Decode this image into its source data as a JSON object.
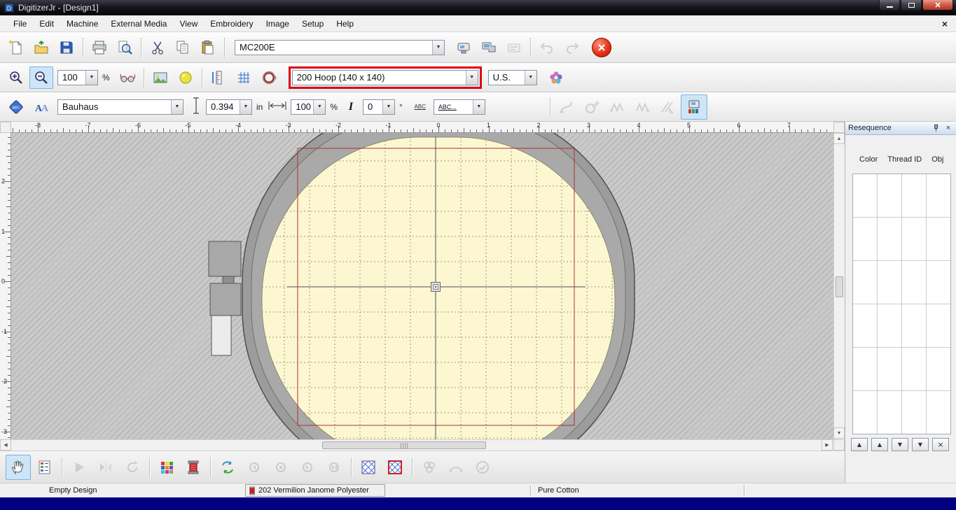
{
  "titlebar": {
    "title": "DigitizerJr - [Design1]"
  },
  "menubar": {
    "items": [
      "File",
      "Edit",
      "Machine",
      "External Media",
      "View",
      "Embroidery",
      "Image",
      "Setup",
      "Help"
    ]
  },
  "toolbar_standard": {
    "machine_value": "MC200E"
  },
  "toolbar_view": {
    "zoom_value": "100",
    "zoom_percent": "%",
    "hoop_value": "200 Hoop (140 x 140)",
    "units_value": "U.S."
  },
  "toolbar_lettering": {
    "font_value": "Bauhaus",
    "height_value": "0.394",
    "height_unit": "in",
    "width_value": "100",
    "width_percent": "%",
    "italic_glyph": "I",
    "angle_value": "0",
    "angle_unit": "°",
    "abc_glyph": "ABC",
    "baseline_value": "ABC..."
  },
  "rulers": {
    "horizontal_labels": [
      "-8",
      "-7",
      "-6",
      "-5",
      "-4",
      "-3",
      "-2",
      "-1",
      "0",
      "1",
      "2",
      "3",
      "4",
      "5",
      "6",
      "7"
    ],
    "vertical_labels": [
      "2",
      "1",
      "0",
      "-1",
      "-2",
      "-3"
    ]
  },
  "resequence": {
    "title": "Resequence",
    "columns": [
      "Color",
      "Thread ID",
      "Obj"
    ],
    "buttons": [
      "▲",
      "▲",
      "▼",
      "▼",
      "×"
    ]
  },
  "statusbar": {
    "design_status": "Empty Design",
    "thread": "202 Vermilion Janome Polyester",
    "fabric": "Pure Cotton"
  },
  "icons": {
    "combo_arrow": "▼",
    "scroll_up": "▲",
    "scroll_down": "▼",
    "scroll_left": "◀",
    "scroll_right": "▶",
    "mdi_close": "×",
    "panel_close": "×"
  },
  "colors": {
    "annotation_red": "#e10013",
    "selection_blue": "#cde6f7",
    "hoop_area_fill": "#fcf7d0",
    "stitch_boundary": "#b03030",
    "canvas_hatch": "#c9c9c9"
  }
}
